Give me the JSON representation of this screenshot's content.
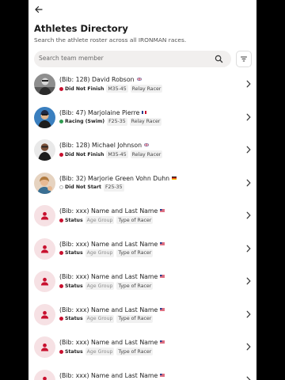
{
  "header": {
    "title": "Athletes Directory",
    "subtitle": "Search the athlete roster across all IRONMAN races."
  },
  "search": {
    "placeholder": "Search team member"
  },
  "colors": {
    "accent": "#c8102e",
    "placeholder_bg": "#f6e1e4",
    "dnf": "#c8102e",
    "racing": "#2e9b4f",
    "dns": "#bbbbbb"
  },
  "athletes": [
    {
      "name": "(Bib: 128) David Robson",
      "flag": "gb",
      "status": "Did Not Finish",
      "status_kind": "dnf",
      "age_group": "M35-45",
      "racer_type": "Relay Racer",
      "avatar": "photo"
    },
    {
      "name": "(Bib: 47) Marjolaine Pierre",
      "flag": "fr",
      "status": "Racing (Swim)",
      "status_kind": "racing",
      "age_group": "F25-35",
      "racer_type": "Relay Racer",
      "avatar": "photo"
    },
    {
      "name": "(Bib: 128) Michael Johnson",
      "flag": "gb",
      "status": "Did Not Finish",
      "status_kind": "dnf",
      "age_group": "M35-45",
      "racer_type": "Relay Racer",
      "avatar": "photo"
    },
    {
      "name": "(Bib: 32) Marjorie Green Vohn Duhn",
      "flag": "de",
      "status": "Did Not Start",
      "status_kind": "dns",
      "age_group": "F25-35",
      "racer_type": "",
      "avatar": "photo"
    },
    {
      "name": "(Bib: xxx) Name and Last Name",
      "flag": "us",
      "status": "Status",
      "status_kind": "dnf",
      "age_group": "Age Group",
      "racer_type": "Type of Racer",
      "avatar": "placeholder"
    },
    {
      "name": "(Bib: xxx) Name and Last Name",
      "flag": "us",
      "status": "Status",
      "status_kind": "dnf",
      "age_group": "Age Group",
      "racer_type": "Type of Racer",
      "avatar": "placeholder"
    },
    {
      "name": "(Bib: xxx) Name and Last Name",
      "flag": "us",
      "status": "Status",
      "status_kind": "dnf",
      "age_group": "Age Group",
      "racer_type": "Type of Racer",
      "avatar": "placeholder"
    },
    {
      "name": "(Bib: xxx) Name and Last Name",
      "flag": "us",
      "status": "Status",
      "status_kind": "dnf",
      "age_group": "Age Group",
      "racer_type": "Type of Racer",
      "avatar": "placeholder"
    },
    {
      "name": "(Bib: xxx) Name and Last Name",
      "flag": "us",
      "status": "Status",
      "status_kind": "dnf",
      "age_group": "Age Group",
      "racer_type": "Type of Racer",
      "avatar": "placeholder"
    },
    {
      "name": "(Bib: xxx) Name and Last Name",
      "flag": "us",
      "status": "Status",
      "status_kind": "dnf",
      "age_group": "Age Group",
      "racer_type": "Type of Racer",
      "avatar": "placeholder"
    }
  ]
}
